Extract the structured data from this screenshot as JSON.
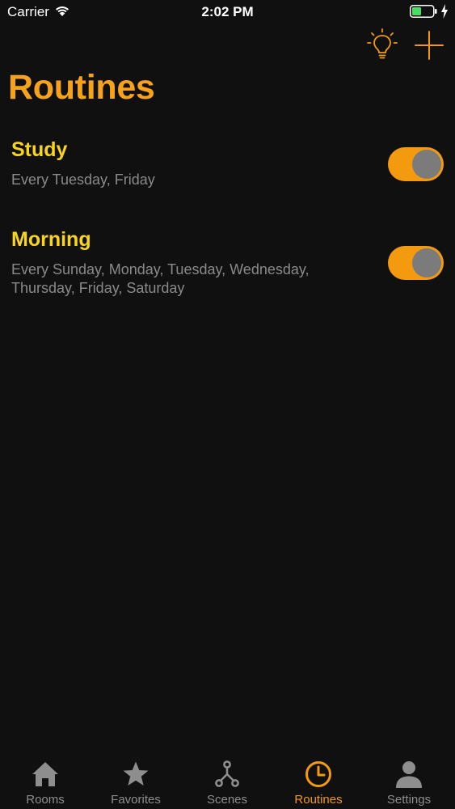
{
  "status_bar": {
    "carrier": "Carrier",
    "time": "2:02 PM",
    "battery_color": "#4cd964"
  },
  "nav": {
    "bulb_icon": "lightbulb-icon",
    "add_icon": "plus-icon"
  },
  "page": {
    "title": "Routines"
  },
  "routines": [
    {
      "name": "Study",
      "days": "Every Tuesday, Friday",
      "enabled": true
    },
    {
      "name": "Morning",
      "days": "Every Sunday, Monday, Tuesday, Wednesday, Thursday, Friday, Saturday",
      "enabled": true
    }
  ],
  "tab_bar": {
    "tabs": [
      {
        "label": "Rooms",
        "icon": "house-icon",
        "active": false
      },
      {
        "label": "Favorites",
        "icon": "star-icon",
        "active": false
      },
      {
        "label": "Scenes",
        "icon": "scenes-icon",
        "active": false
      },
      {
        "label": "Routines",
        "icon": "clock-icon",
        "active": true
      },
      {
        "label": "Settings",
        "icon": "person-icon",
        "active": false
      }
    ]
  },
  "colors": {
    "accent": "#f39a0f",
    "title": "#f7a21b",
    "routine_name": "#f9d51a",
    "subtitle": "#8a8a8a",
    "background": "#101010"
  }
}
